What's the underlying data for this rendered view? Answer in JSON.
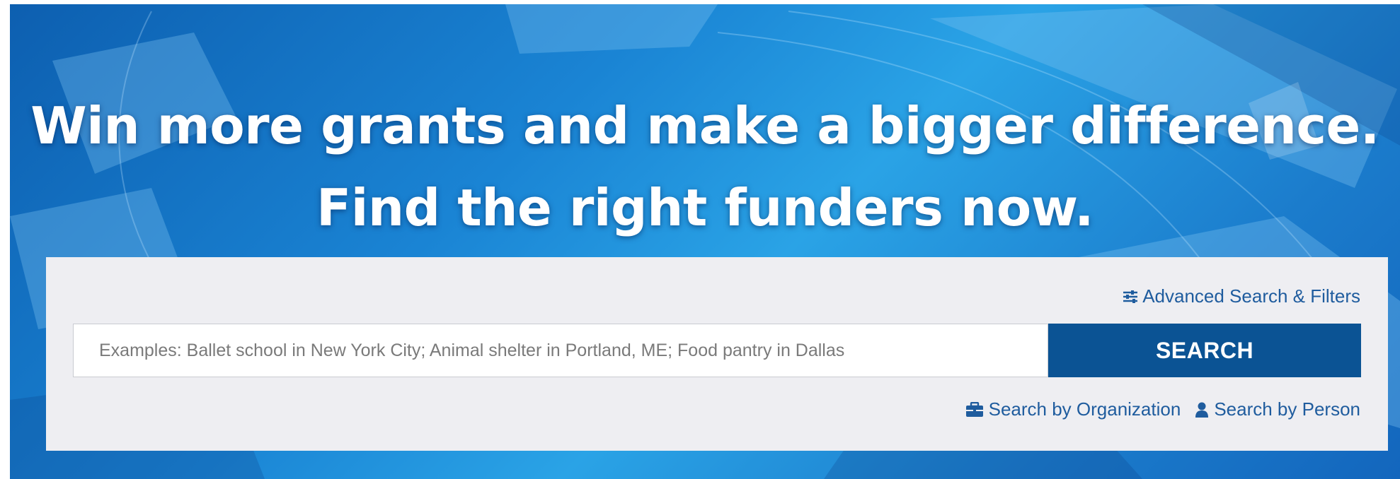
{
  "hero": {
    "headline_line1": "Win more grants and make a bigger difference.",
    "headline_line2": "Find the right funders now."
  },
  "search": {
    "advanced_label": "Advanced Search & Filters",
    "advanced_icon": "sliders-icon",
    "placeholder": "Examples: Ballet school in New York City; Animal shelter in Portland, ME; Food pantry in Dallas",
    "button_label": "SEARCH",
    "org_link_label": "Search by Organization",
    "org_link_icon": "briefcase-icon",
    "person_link_label": "Search by Person",
    "person_link_icon": "user-icon"
  },
  "colors": {
    "accent": "#0b5394",
    "link": "#1f5c9e",
    "panel_bg": "#eeeef2",
    "hero_blue": "#1a84d4"
  }
}
